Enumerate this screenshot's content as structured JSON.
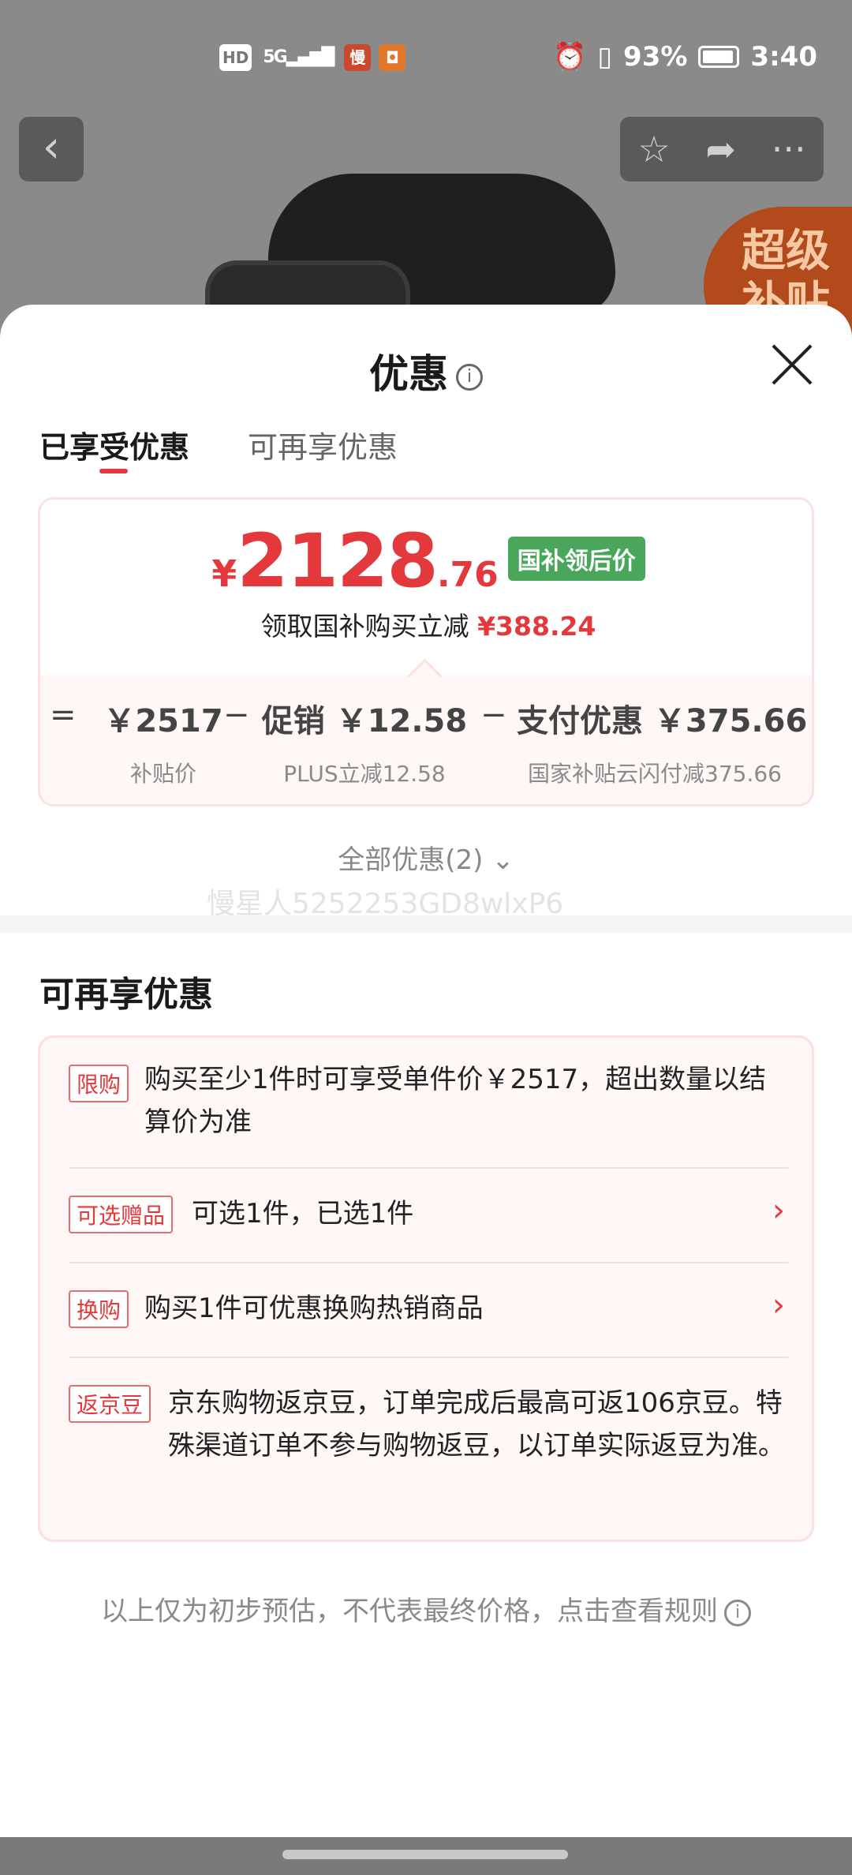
{
  "status_bar": {
    "hd": "HD",
    "signal": "5G",
    "battery": "93%",
    "time": "3:40"
  },
  "background": {
    "promo_badge_line1": "超级",
    "promo_badge_line2": "补贴"
  },
  "sheet": {
    "title": "优惠",
    "tabs": [
      {
        "label": "已享受优惠",
        "active": true
      },
      {
        "label": "可再享优惠",
        "active": false
      }
    ],
    "price": {
      "currency": "¥",
      "integer": "2128",
      "decimal": ".76",
      "badge": "国补领后价",
      "claim_text": "领取国补购买立减",
      "claim_amount": "¥388.24"
    },
    "breakdown": {
      "eq": "=",
      "minus": "−",
      "items": [
        {
          "value": "￥2517",
          "sub": "补贴价"
        },
        {
          "value": "促销 ￥12.58",
          "sub": "PLUS立减12.58"
        },
        {
          "value": "支付优惠 ￥375.66",
          "sub": "国家补贴云闪付减375.66"
        }
      ]
    },
    "all_offers": "全部优惠(2) ⌄",
    "watermark": "慢星人5252253GD8wlxP6",
    "section_title": "可再享优惠",
    "offers": [
      {
        "tag": "限购",
        "text": "购买至少1件时可享受单件价￥2517，超出数量以结算价为准",
        "has_arrow": false
      },
      {
        "tag": "可选赠品",
        "text": "可选1件，已选1件",
        "has_arrow": true
      },
      {
        "tag": "换购",
        "text": "购买1件可优惠换购热销商品",
        "has_arrow": true
      },
      {
        "tag": "返京豆",
        "text": "京东购物返京豆，订单完成后最高可返106京豆。特殊渠道订单不参与购物返豆，以订单实际返豆为准。",
        "has_arrow": false
      }
    ],
    "footer_note": "以上仅为初步预估，不代表最终价格，点击查看规则"
  },
  "colors": {
    "accent_red": "#e4393c",
    "badge_green": "#4aa65a",
    "card_bg": "#fff6f6",
    "card_border": "#fbe1e2"
  }
}
